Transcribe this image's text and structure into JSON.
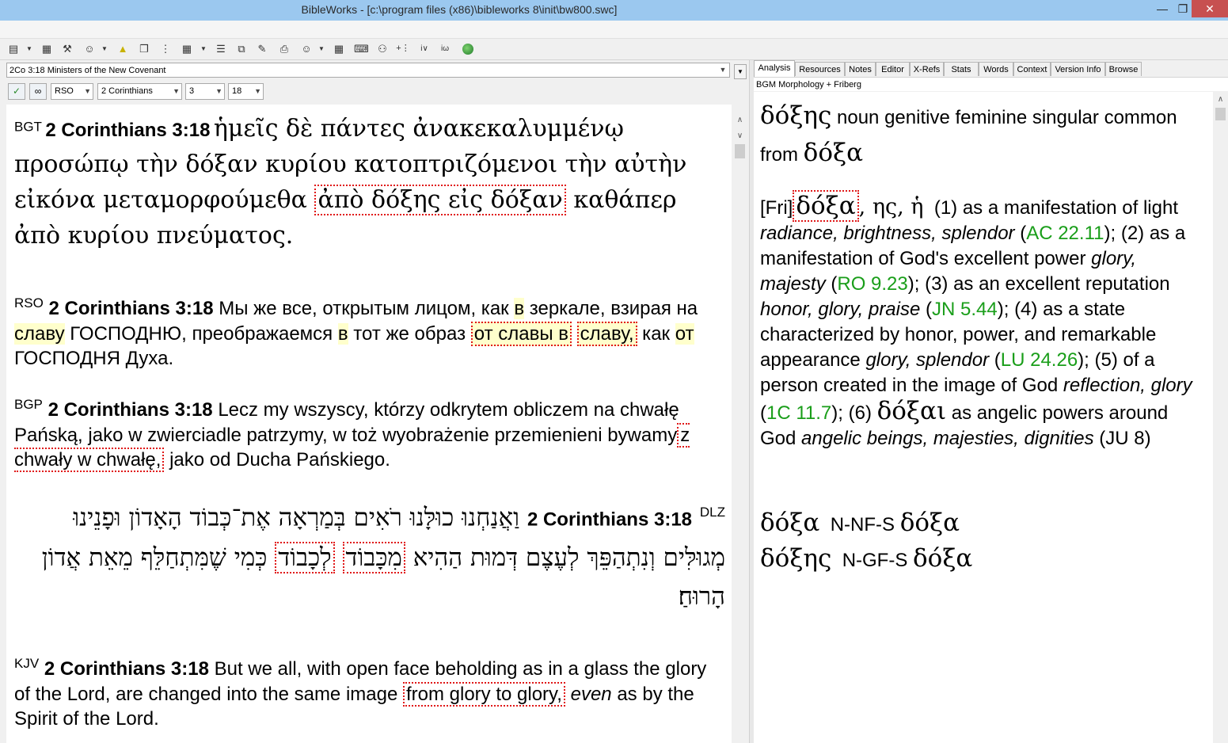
{
  "window": {
    "title": "BibleWorks - [c:\\program files (x86)\\bibleworks 8\\init\\bw800.swc]"
  },
  "toolbar": {
    "icons": [
      "stack-icon",
      "bookmark-icon",
      "tools-icon",
      "user-icon",
      "search-icon",
      "windows-icon",
      "flow-icon",
      "grid-icon",
      "list-icon",
      "copy-icon",
      "edit-icon",
      "print-icon",
      "user2-icon",
      "layout-icon",
      "dictionary-icon",
      "person-icon",
      "plus-icon",
      "verse-icon",
      "web-icon",
      "globe-icon"
    ]
  },
  "left": {
    "reference_text": "2Co 3:18 Ministers of the New Covenant",
    "version_select": "RSO",
    "book_select": "2 Corinthians",
    "chapter_select": "3",
    "verse_select": "18"
  },
  "verses": {
    "bgt": {
      "tag": "BGT",
      "ref": "2 Corinthians 3:18",
      "text_a": "ἡμεῖς δὲ πάντες ἀνακεκαλυμμένῳ προσώπῳ τὴν δόξαν κυρίου κατοπτριζόμενοι τὴν αὐτὴν εἰκόνα μεταμορφούμεθα ",
      "highlight": "ἀπὸ δόξης εἰς δόξαν",
      "text_b": " καθάπερ ἀπὸ κυρίου πνεύματος."
    },
    "rso": {
      "tag": "RSO",
      "ref": "2 Corinthians 3:18",
      "t1": "Мы же все, открытым лицом, как ",
      "y1": "в",
      "t2": " зеркале, взирая на ",
      "y2": "славу",
      "t3": " ГОСПОДНЮ, преображаемся ",
      "y3": "в",
      "t4": " тот же образ ",
      "h1": "от славы в",
      "h2": "славу,",
      "t5": " как ",
      "y4": "от",
      "t6": " ГОСПОДНЯ Духа."
    },
    "bgp": {
      "tag": "BGP",
      "ref": "2 Corinthians 3:18",
      "text_a": "Lecz my wszyscy, którzy odkrytem obliczem na chwałę Pańską, jako w zwierciadle patrzymy, w toż wyobrażenie przemienieni bywamy",
      "highlight": "z chwały w chwałę,",
      "text_b": " jako od Ducha Pańskiego."
    },
    "dlz": {
      "tag": "DLZ",
      "ref": "2 Corinthians 3:18",
      "text_a": "וַאֲנַחְנוּ כוּלָּנוּ רֹאִים בְּמַרְאָה אֶת־כְּבוֹד הָאָדוֹן וּפָנֵינוּ מְגוּלִּים וְנִתְהַפֵּךְ לְעֶצֶם דְּמוּת הַהִיא ",
      "highlight1": "מִכָּבוֹד",
      "mid": " ",
      "highlight2": "לְכָבוֹד",
      "text_b": " כְּמִי שֶׁמִּתְחַלֵּף מֵאֵת אֲדוֹן הָרוּחַ׃"
    },
    "kjv": {
      "tag": "KJV",
      "ref": "2 Corinthians 3:18",
      "text_a": "But we all, with open face beholding as in a glass the glory of the Lord, are changed into the same image ",
      "highlight": "from glory to glory,",
      "italic": "even",
      "text_b": " as by the Spirit of the Lord."
    }
  },
  "right": {
    "tabs": [
      "Analysis",
      "Resources",
      "Notes",
      "Editor",
      "X-Refs",
      "Stats",
      "Words",
      "Context",
      "Version Info",
      "Browse"
    ],
    "subheader": "BGM Morphology + Friberg",
    "word": "δόξης",
    "parse": "noun genitive feminine singular common from",
    "lemma": "δόξα",
    "fri_prefix": "[Fri]",
    "fri_word": "δόξα",
    "fri_forms": ", ης, ἡ",
    "defs": {
      "d1": "(1) as a manifestation of light ",
      "d1i": "radiance, brightness, splendor",
      "r1": "AC 22.11",
      "d2": "); (2) as a manifestation of God's excellent power ",
      "d2i": "glory, majesty",
      "r2": "RO 9.23",
      "d3": "); (3) as an excellent reputation ",
      "d3i": "honor, glory, praise",
      "r3": "JN 5.44",
      "d4": "); (4) as a state characterized by honor, power, and remarkable appearance ",
      "d4i": "glory, splendor",
      "r4": "LU 24.26",
      "d5": "); (5) of a person created in the image of God ",
      "d5i": "reflection, glory",
      "r5": "1C 11.7",
      "d6": "); (6) ",
      "d6g": "δόξαι",
      "d6t": " as angelic powers around God ",
      "d6i": "angelic beings, majesties, dignities",
      "d6e": " (JU 8)"
    },
    "morph1_word": "δόξα",
    "morph1_code": "N-NF-S",
    "morph1_lemma": "δόξα",
    "morph2_word": "δόξης",
    "morph2_code": "N-GF-S",
    "morph2_lemma": "δόξα"
  }
}
